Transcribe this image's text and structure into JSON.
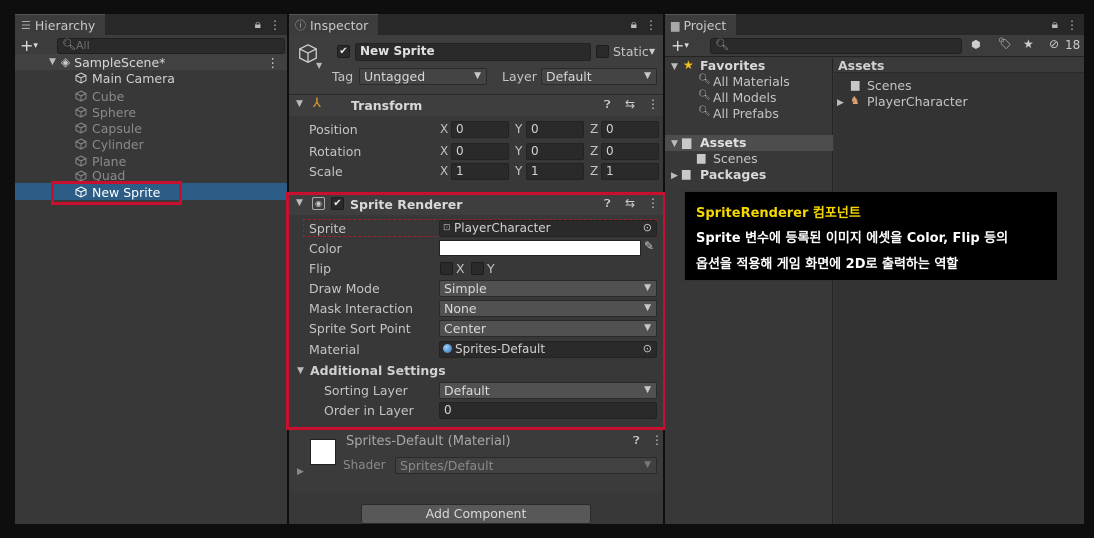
{
  "hierarchy": {
    "tab_label": "Hierarchy",
    "search_placeholder": "All",
    "scene_name": "SampleScene*",
    "items": [
      {
        "label": "Main Camera"
      },
      {
        "label": "Cube"
      },
      {
        "label": "Sphere"
      },
      {
        "label": "Capsule"
      },
      {
        "label": "Cylinder"
      },
      {
        "label": "Plane"
      },
      {
        "label": "Quad"
      },
      {
        "label": "New Sprite"
      }
    ]
  },
  "inspector": {
    "tab_label": "Inspector",
    "object_name": "New Sprite",
    "static_label": "Static",
    "tag_label": "Tag",
    "tag_value": "Untagged",
    "layer_label": "Layer",
    "layer_value": "Default",
    "transform": {
      "title": "Transform",
      "position_label": "Position",
      "rotation_label": "Rotation",
      "scale_label": "Scale",
      "position": {
        "x": "0",
        "y": "0",
        "z": "0"
      },
      "rotation": {
        "x": "0",
        "y": "0",
        "z": "0"
      },
      "scale": {
        "x": "1",
        "y": "1",
        "z": "1"
      }
    },
    "axes": {
      "x": "X",
      "y": "Y",
      "z": "Z"
    },
    "sprite_renderer": {
      "title": "Sprite Renderer",
      "sprite_label": "Sprite",
      "sprite_value": "PlayerCharacter",
      "color_label": "Color",
      "color_value": "#ffffff",
      "flip_label": "Flip",
      "flip_x": "X",
      "flip_y": "Y",
      "draw_mode_label": "Draw Mode",
      "draw_mode_value": "Simple",
      "mask_label": "Mask Interaction",
      "mask_value": "None",
      "sort_point_label": "Sprite Sort Point",
      "sort_point_value": "Center",
      "material_label": "Material",
      "material_value": "Sprites-Default",
      "additional_label": "Additional Settings",
      "sorting_layer_label": "Sorting Layer",
      "sorting_layer_value": "Default",
      "order_label": "Order in Layer",
      "order_value": "0"
    },
    "material": {
      "title": "Sprites-Default (Material)",
      "shader_label": "Shader",
      "shader_value": "Sprites/Default"
    },
    "add_component_label": "Add Component"
  },
  "project": {
    "tab_label": "Project",
    "hidden_count": "18",
    "favorites_label": "Favorites",
    "favorites": [
      {
        "label": "All Materials"
      },
      {
        "label": "All Models"
      },
      {
        "label": "All Prefabs"
      }
    ],
    "assets_label": "Assets",
    "scenes_label": "Scenes",
    "packages_label": "Packages",
    "assets_header": "Assets",
    "asset_items": [
      {
        "label": "Scenes"
      },
      {
        "label": "PlayerCharacter"
      }
    ]
  },
  "annotation": {
    "title": "SpriteRenderer 컴포넌트",
    "line1": "Sprite 변수에 등록된 이미지 에셋을 Color, Flip 등의",
    "line2": "옵션을 적용해 게임 화면에 2D로 출력하는 역할"
  },
  "colors": {
    "selection": "#2c5d87",
    "highlight_border": "#c8102e",
    "annotation_title": "#f5d800"
  }
}
